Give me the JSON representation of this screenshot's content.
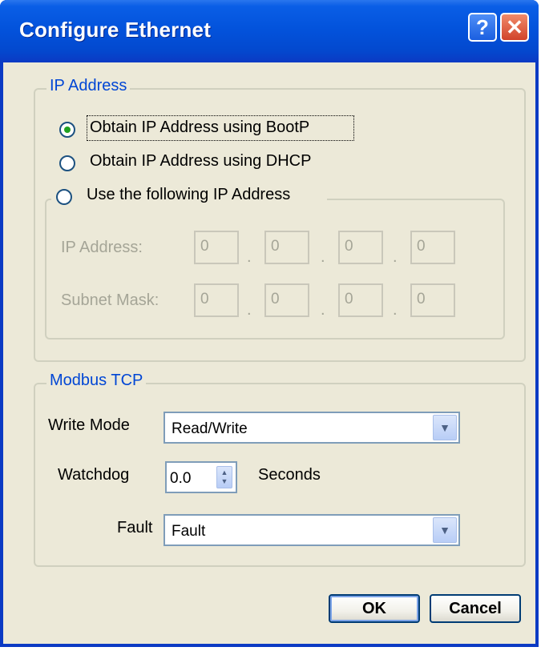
{
  "window": {
    "title": "Configure Ethernet",
    "help_label": "?",
    "close_label": "✕"
  },
  "ip_address": {
    "group_label": "IP Address",
    "options": [
      {
        "label": "Obtain IP Address using BootP",
        "checked": true
      },
      {
        "label": "Obtain IP Address using DHCP",
        "checked": false
      },
      {
        "label": "Use the following IP Address",
        "checked": false
      }
    ],
    "ip_label": "IP Address:",
    "ip_octets": [
      "0",
      "0",
      "0",
      "0"
    ],
    "subnet_label": "Subnet Mask:",
    "subnet_octets": [
      "0",
      "0",
      "0",
      "0"
    ],
    "separator": "."
  },
  "modbus": {
    "group_label": "Modbus TCP",
    "write_mode_label": "Write Mode",
    "write_mode_value": "Read/Write",
    "watchdog_label": "Watchdog",
    "watchdog_value": "0.0",
    "watchdog_unit": "Seconds",
    "fault_label": "Fault",
    "fault_value": "Fault"
  },
  "buttons": {
    "ok": "OK",
    "cancel": "Cancel"
  },
  "colors": {
    "titlebar": "#0353dc",
    "group_label": "#0046d5",
    "dialog_bg": "#ece9d8",
    "radio_checked": "#21a121"
  }
}
